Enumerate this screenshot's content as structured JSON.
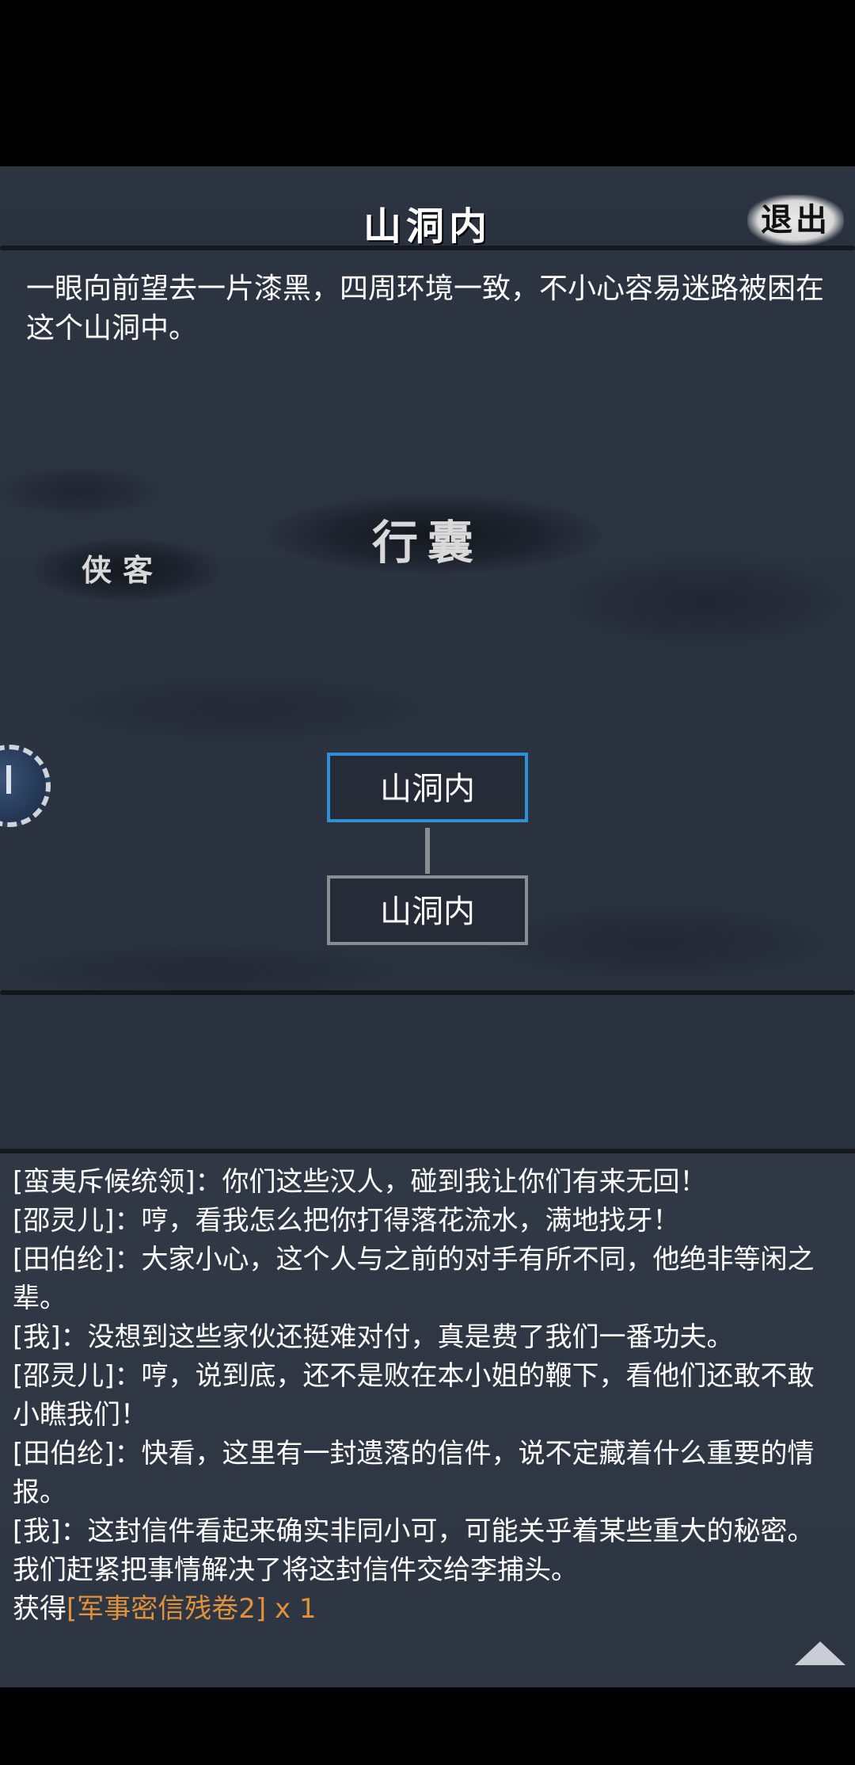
{
  "header": {
    "title": "山洞内",
    "exit_label": "退出"
  },
  "scene": {
    "description": "一眼向前望去一片漆黑，四周环境一致，不小心容易迷路被困在这个山洞中。"
  },
  "menu": {
    "bag_label": "行囊",
    "hero_label": "侠客"
  },
  "map": {
    "nodes": [
      {
        "label": "山洞内",
        "current": true
      },
      {
        "label": "山洞内",
        "current": false
      }
    ]
  },
  "log": {
    "lines": [
      "[蛮夷斥候统领]：你们这些汉人，碰到我让你们有来无回！",
      "[邵灵儿]：哼，看我怎么把你打得落花流水，满地找牙！",
      "[田伯纶]：大家小心，这个人与之前的对手有所不同，他绝非等闲之辈。",
      "[我]：没想到这些家伙还挺难对付，真是费了我们一番功夫。",
      "[邵灵儿]：哼，说到底，还不是败在本小姐的鞭下，看他们还敢不敢小瞧我们！",
      "[田伯纶]：快看，这里有一封遗落的信件，说不定藏着什么重要的情报。",
      "[我]：这封信件看起来确实非同小可，可能关乎着某些重大的秘密。我们赶紧把事情解决了将这封信件交给李捕头。"
    ],
    "reward_prefix": "获得",
    "reward_item": "[军事密信残卷2]",
    "reward_count": " x 1"
  },
  "colors": {
    "current_node_border": "#2f8fd8",
    "reward_item": "#e0913a"
  },
  "icons": {
    "scroll_up": "triangle-up-icon",
    "side_emblem": "round-badge-icon"
  }
}
